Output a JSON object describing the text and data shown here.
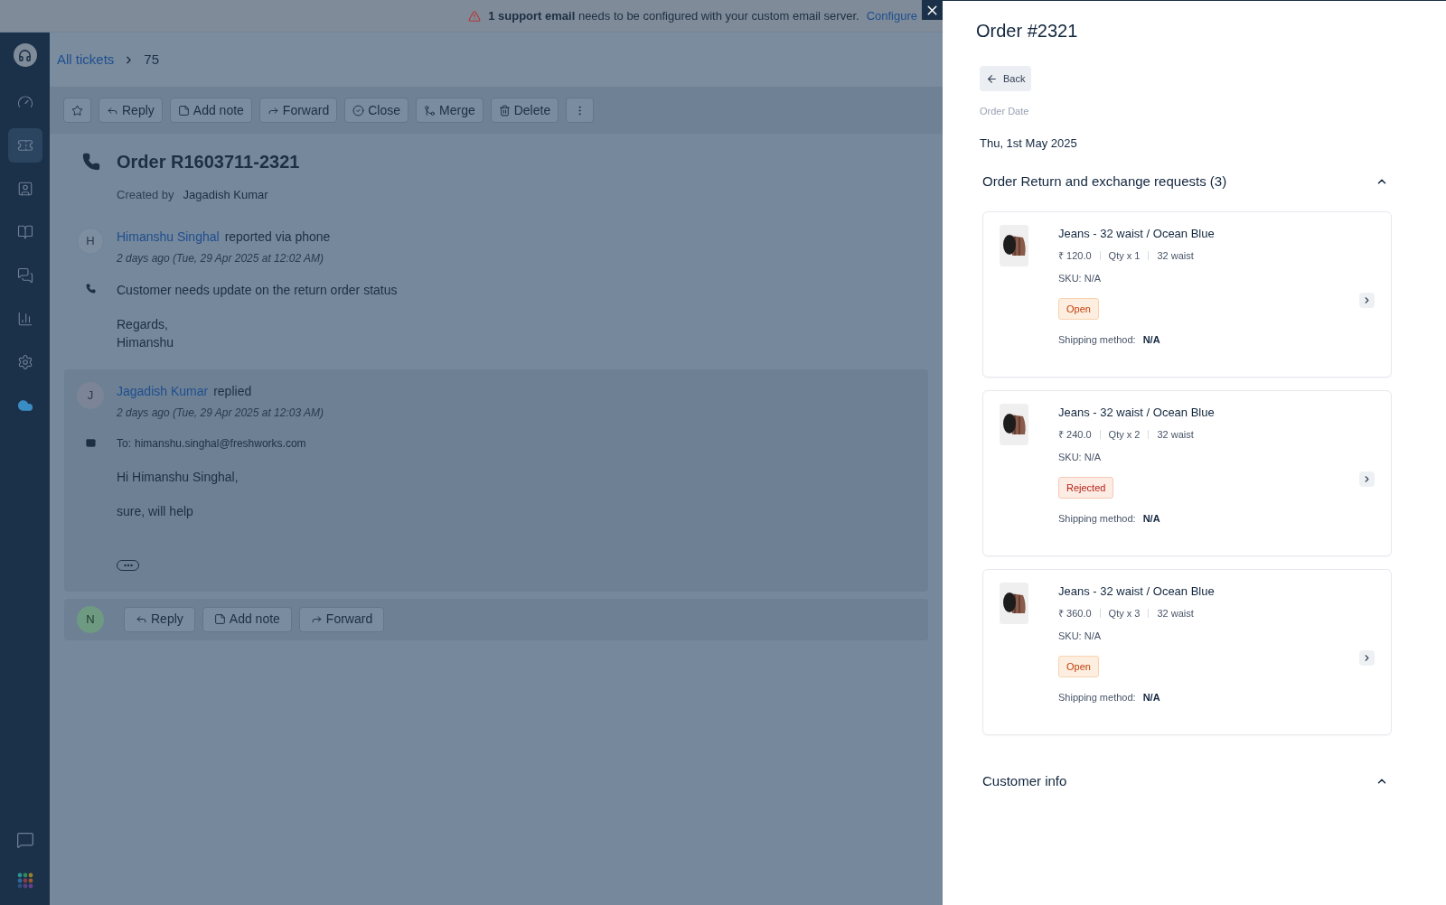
{
  "banner": {
    "message": "**1 support email** needs to be configured with your custom email server.",
    "link": "Configure"
  },
  "sidebar": {
    "items": [
      {
        "kind": "dashboard",
        "selected": false
      },
      {
        "kind": "tickets",
        "selected": true
      },
      {
        "kind": "contacts",
        "selected": false
      },
      {
        "kind": "solutions",
        "selected": false
      },
      {
        "kind": "discussions",
        "selected": false
      },
      {
        "kind": "reports",
        "selected": false
      },
      {
        "kind": "settings",
        "selected": false
      },
      {
        "kind": "cloud",
        "selected": false
      }
    ],
    "bottom_items": [
      {
        "kind": "chat"
      },
      {
        "kind": "apps"
      }
    ]
  },
  "breadcrumb": {
    "link": "All tickets",
    "current": "75"
  },
  "toolbar": [
    {
      "kind": "star"
    },
    {
      "kind": "reply",
      "label": "Reply"
    },
    {
      "kind": "note",
      "label": "Add note"
    },
    {
      "kind": "forward",
      "label": "Forward"
    },
    {
      "kind": "close",
      "label": "Close"
    },
    {
      "kind": "merge",
      "label": "Merge"
    },
    {
      "kind": "delete",
      "label": "Delete"
    },
    {
      "kind": "more"
    }
  ],
  "ticket": {
    "title": "Order R1603711-2321",
    "created_by_label": "Created by",
    "created_by": "Jagadish Kumar"
  },
  "conversations": [
    {
      "kind": "phone",
      "avatar": "H",
      "author": "Himanshu Singhal",
      "action": "reported via phone",
      "time": "2 days ago (Tue, 29 Apr 2025 at 12:02 AM)",
      "paragraphs": [
        "Customer needs update on the return order status",
        "Regards,\nHimanshu"
      ]
    },
    {
      "kind": "email",
      "avatar": "J",
      "author": "Jagadish Kumar",
      "action": "replied",
      "time": "2 days ago (Tue, 29 Apr 2025 at 12:03 AM)",
      "to_label": "To:",
      "to": "himanshu.singhal@freshworks.com",
      "paragraphs": [
        "Hi Himanshu Singhal,",
        "sure, will help"
      ]
    }
  ],
  "reply_bar": {
    "avatar": "N",
    "buttons": [
      {
        "kind": "reply",
        "label": "Reply"
      },
      {
        "kind": "note",
        "label": "Add note"
      },
      {
        "kind": "forward",
        "label": "Forward"
      }
    ]
  },
  "panel": {
    "title": "Order #2321",
    "back": "Back",
    "order_date_label": "Order Date",
    "order_date": "Thu, 1st May 2025",
    "sections": [
      {
        "title": "Order Return and exchange requests (3)",
        "expanded": true,
        "items": [
          {
            "name": "Jeans - 32 waist / Ocean Blue",
            "price": "₹ 120.0",
            "qty": "Qty x 1",
            "variant": "32 waist",
            "sku": "SKU: N/A",
            "status": {
              "label": "Open",
              "kind": "open"
            },
            "shipping_label": "Shipping method:",
            "shipping": "N/A"
          },
          {
            "name": "Jeans - 32 waist / Ocean Blue",
            "price": "₹ 240.0",
            "qty": "Qty x 2",
            "variant": "32 waist",
            "sku": "SKU: N/A",
            "status": {
              "label": "Rejected",
              "kind": "rejected"
            },
            "shipping_label": "Shipping method:",
            "shipping": "N/A"
          },
          {
            "name": "Jeans - 32 waist / Ocean Blue",
            "price": "₹ 360.0",
            "qty": "Qty x 3",
            "variant": "32 waist",
            "sku": "SKU: N/A",
            "status": {
              "label": "Open",
              "kind": "open"
            },
            "shipping_label": "Shipping method:",
            "shipping": "N/A"
          }
        ]
      },
      {
        "title": "Customer info",
        "expanded": true
      }
    ]
  }
}
